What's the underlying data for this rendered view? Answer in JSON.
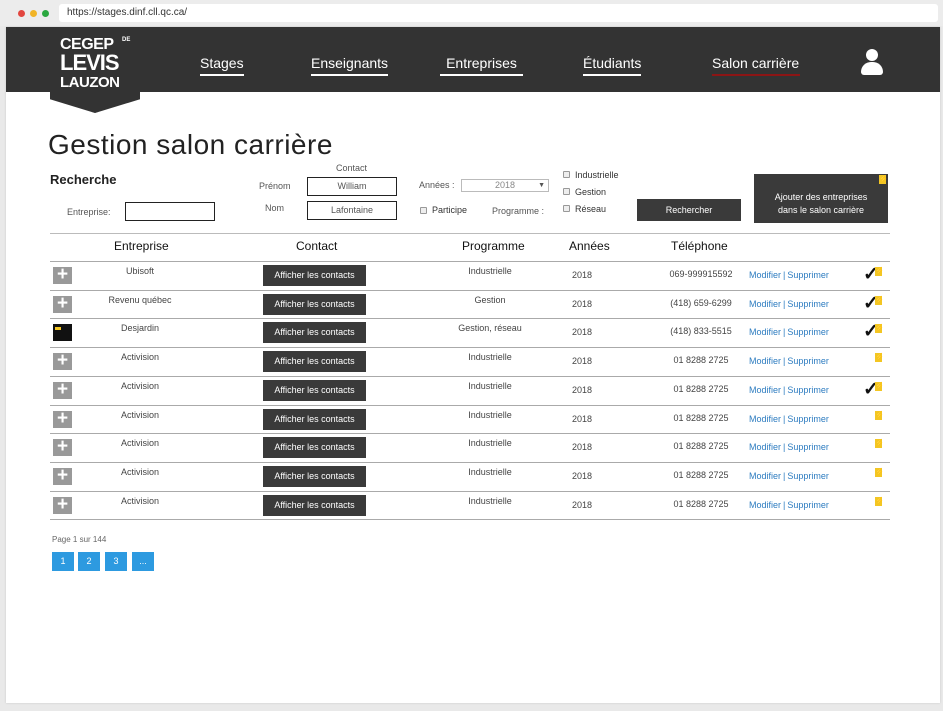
{
  "browser": {
    "url": "https://stages.dinf.cll.qc.ca/"
  },
  "logo": {
    "line1": "CEGEP",
    "line1b": "DE",
    "line2": "LEVIS",
    "line3": "LAUZON"
  },
  "nav": {
    "items": [
      {
        "label": "Stages"
      },
      {
        "label": "Enseignants"
      },
      {
        "label": "Entreprises"
      },
      {
        "label": "Étudiants"
      },
      {
        "label": "Salon carrière"
      }
    ],
    "active": "Salon carrière"
  },
  "page": {
    "title": "Gestion salon carrière"
  },
  "search": {
    "title": "Recherche",
    "entreprise_label": "Entreprise:",
    "entreprise_value": "",
    "contact_label": "Contact",
    "prenom_label": "Prénom",
    "prenom_value": "William",
    "nom_label": "Nom",
    "nom_value": "Lafontaine",
    "annees_label": "Années :",
    "annees_value": "2018",
    "participe_label": "Participe",
    "programme_label": "Programme :",
    "programme_options": [
      "Industrielle",
      "Gestion",
      "Réseau"
    ],
    "search_button": "Rechercher",
    "add_button_line1": "Ajouter des entreprises",
    "add_button_line2": "dans le salon carrière"
  },
  "table": {
    "headers": [
      "Entreprise",
      "Contact",
      "Programme",
      "Années",
      "Téléphone"
    ],
    "contact_button": "Afficher les contacts",
    "modify_label": "Modifier",
    "delete_label": "Supprimer",
    "rows": [
      {
        "entreprise": "Ubisoft",
        "programme": "Industrielle",
        "annee": "2018",
        "telephone": "069-999915592",
        "icon": "plus",
        "check": true,
        "bolt": true
      },
      {
        "entreprise": "Revenu québec",
        "programme": "Gestion",
        "annee": "2018",
        "telephone": "(418) 659-6299",
        "icon": "plus",
        "check": true,
        "bolt": true
      },
      {
        "entreprise": "Desjardin",
        "programme": "Gestion, réseau",
        "annee": "2018",
        "telephone": "(418) 833-5515",
        "icon": "folder",
        "check": true,
        "bolt": true
      },
      {
        "entreprise": "Activision",
        "programme": "Industrielle",
        "annee": "2018",
        "telephone": "01 8288 2725",
        "icon": "plus",
        "check": false,
        "bolt": true
      },
      {
        "entreprise": "Activision",
        "programme": "Industrielle",
        "annee": "2018",
        "telephone": "01 8288 2725",
        "icon": "plus",
        "check": true,
        "bolt": true
      },
      {
        "entreprise": "Activision",
        "programme": "Industrielle",
        "annee": "2018",
        "telephone": "01 8288 2725",
        "icon": "plus",
        "check": false,
        "bolt": true
      },
      {
        "entreprise": "Activision",
        "programme": "Industrielle",
        "annee": "2018",
        "telephone": "01 8288 2725",
        "icon": "plus",
        "check": false,
        "bolt": true
      },
      {
        "entreprise": "Activision",
        "programme": "Industrielle",
        "annee": "2018",
        "telephone": "01 8288 2725",
        "icon": "plus",
        "check": false,
        "bolt": true
      },
      {
        "entreprise": "Activision",
        "programme": "Industrielle",
        "annee": "2018",
        "telephone": "01 8288 2725",
        "icon": "plus",
        "check": false,
        "bolt": true
      }
    ]
  },
  "pagination": {
    "text": "Page 1 sur 144",
    "pages": [
      "1",
      "2",
      "3",
      "..."
    ]
  },
  "colors": {
    "header": "#333333",
    "accent_active": "#8c1515",
    "link": "#2d7cc0",
    "pager": "#2d9ae0",
    "bolt": "#f3c623"
  }
}
